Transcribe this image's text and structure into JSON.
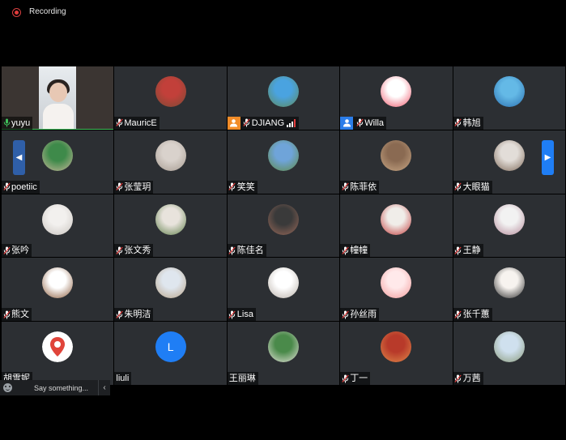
{
  "recording": {
    "label": "Recording"
  },
  "chat": {
    "placeholder": "Say something..."
  },
  "participants": [
    {
      "name": "yuyu",
      "type": "video",
      "mic": "active"
    },
    {
      "name": "MauricE",
      "type": "avatar",
      "colors": [
        "#c2403a",
        "#7a4a35"
      ]
    },
    {
      "name": "DJIANG",
      "type": "avatar",
      "colors": [
        "#4aa3e0",
        "#5f8a5a"
      ],
      "badge": "orange",
      "signal": true
    },
    {
      "name": "Willa",
      "type": "avatar",
      "colors": [
        "#ffffff",
        "#f0566a"
      ],
      "badge": "blue"
    },
    {
      "name": "韩旭",
      "type": "avatar",
      "colors": [
        "#64b9e6",
        "#2a6fb0"
      ]
    },
    {
      "name": "poetiic",
      "type": "avatar",
      "colors": [
        "#3e8a4a",
        "#c9b89a"
      ]
    },
    {
      "name": "张莹玥",
      "type": "avatar",
      "colors": [
        "#d9d2cc",
        "#a59a90"
      ]
    },
    {
      "name": "笑笑",
      "type": "avatar",
      "colors": [
        "#6fa4d9",
        "#5f8a45"
      ]
    },
    {
      "name": "陈菲依",
      "type": "avatar",
      "colors": [
        "#8a6a52",
        "#c9a886"
      ]
    },
    {
      "name": "大眼猫",
      "type": "avatar",
      "colors": [
        "#e2ddd8",
        "#7f6a5a"
      ]
    },
    {
      "name": "张吟",
      "type": "avatar",
      "colors": [
        "#f2f0ee",
        "#c9c4bf"
      ]
    },
    {
      "name": "张文秀",
      "type": "avatar",
      "colors": [
        "#e8e3dc",
        "#5f7f4a"
      ]
    },
    {
      "name": "陈佳名",
      "type": "avatar",
      "colors": [
        "#3a3a3a",
        "#9a6a5a"
      ]
    },
    {
      "name": "幢幢",
      "type": "avatar",
      "colors": [
        "#f0ede9",
        "#c23a3a"
      ]
    },
    {
      "name": "王静",
      "type": "avatar",
      "colors": [
        "#f2f2f2",
        "#b58a9a"
      ]
    },
    {
      "name": "熊文",
      "type": "avatar",
      "colors": [
        "#ffffff",
        "#8a5a3a"
      ]
    },
    {
      "name": "朱明洁",
      "type": "avatar",
      "colors": [
        "#dfe6ee",
        "#b9a58a"
      ]
    },
    {
      "name": "Lisa",
      "type": "avatar",
      "colors": [
        "#ffffff",
        "#b8b0a8"
      ]
    },
    {
      "name": "孙丝雨",
      "type": "avatar",
      "colors": [
        "#ffe9ea",
        "#f29a9a"
      ]
    },
    {
      "name": "张千蕙",
      "type": "avatar",
      "colors": [
        "#f7f3ef",
        "#2a2a2a"
      ]
    },
    {
      "name": "胡雪妮",
      "type": "avatar",
      "colors": [
        "#ffffff",
        "#e0443a"
      ],
      "pin": true
    },
    {
      "name": "liuli",
      "type": "letter",
      "letter": "L",
      "colors": [
        "#1f7ef5",
        "#1f7ef5"
      ]
    },
    {
      "name": "王丽琳",
      "type": "avatar",
      "colors": [
        "#4a8a4a",
        "#e8e3dc"
      ]
    },
    {
      "name": "丁一",
      "type": "avatar",
      "colors": [
        "#b83a2a",
        "#e08a4a"
      ]
    },
    {
      "name": "万茜",
      "type": "avatar",
      "colors": [
        "#cfe0ee",
        "#8a9a7a"
      ]
    }
  ],
  "colors": {
    "tile": "#2c2f33",
    "active_border": "#3fbf5a",
    "mic_active": "#3fbf5a",
    "mic_muted": "#e23b3b"
  }
}
